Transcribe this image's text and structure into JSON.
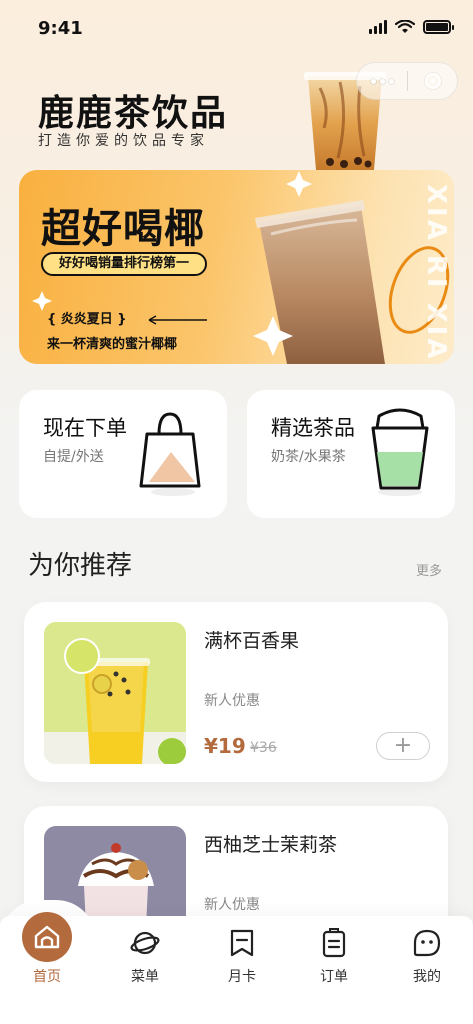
{
  "status_bar": {
    "time": "9:41"
  },
  "header": {
    "title": "鹿鹿茶饮品",
    "subtitle": "打造你爱的饮品专家"
  },
  "banner": {
    "headline": "超好喝椰",
    "pill": "好好喝销量排行榜第一",
    "tag": "{ 炎炎夏日 }",
    "slogan": "来一杯清爽的蜜汁椰椰",
    "vertical_text": "XIA RI XIA",
    "colors": {
      "start": "#f9b03f",
      "end": "#fdebc9"
    }
  },
  "quick_cards": [
    {
      "title": "现在下单",
      "sub": "自提/外送",
      "icon": "shopping-bag-icon"
    },
    {
      "title": "精选茶品",
      "sub": "奶茶/水果茶",
      "icon": "drink-cup-icon"
    }
  ],
  "section": {
    "title": "为你推荐",
    "more": "更多"
  },
  "products": [
    {
      "name": "满杯百香果",
      "promo": "新人优惠",
      "price": "¥19",
      "old_price": "¥36",
      "add": "+"
    },
    {
      "name": "西柚芝士茉莉茶",
      "promo": "新人优惠"
    }
  ],
  "tabbar": {
    "items": [
      {
        "label": "首页",
        "icon": "home-icon"
      },
      {
        "label": "菜单",
        "icon": "planet-icon"
      },
      {
        "label": "月卡",
        "icon": "bookmark-card-icon"
      },
      {
        "label": "订单",
        "icon": "order-clipboard-icon"
      },
      {
        "label": "我的",
        "icon": "profile-face-icon"
      }
    ],
    "active": "首页",
    "accent": "#b36a3d"
  }
}
